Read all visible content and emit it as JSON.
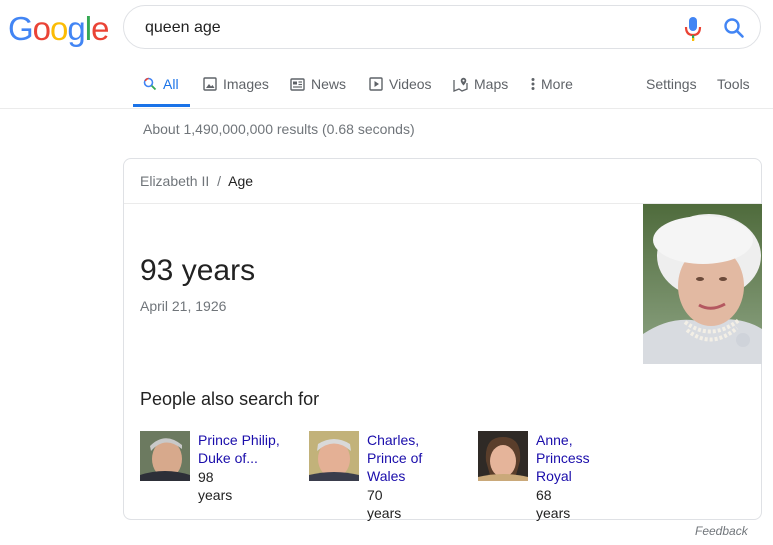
{
  "logo": {
    "letters": [
      "G",
      "o",
      "o",
      "g",
      "l",
      "e"
    ],
    "colors": [
      "#4285f4",
      "#ea4335",
      "#fbbc05",
      "#4285f4",
      "#34a853",
      "#ea4335"
    ]
  },
  "search": {
    "query": "queen age"
  },
  "tabs": [
    {
      "label": "All",
      "icon": "search-icon",
      "active": true
    },
    {
      "label": "Images",
      "icon": "image-icon"
    },
    {
      "label": "News",
      "icon": "news-icon"
    },
    {
      "label": "Videos",
      "icon": "video-icon"
    },
    {
      "label": "Maps",
      "icon": "map-pin-icon"
    },
    {
      "label": "More",
      "icon": "more-vert-icon"
    }
  ],
  "settings_label": "Settings",
  "tools_label": "Tools",
  "result_stats": "About 1,490,000,000 results (0.68 seconds)",
  "card": {
    "breadcrumb_parent": "Elizabeth II",
    "breadcrumb_sep": "/",
    "breadcrumb_current": "Age",
    "age": "93 years",
    "dob": "April 21, 1926",
    "people_heading": "People also search for",
    "people": [
      {
        "name_lines": [
          "Prince Philip,",
          "Duke of..."
        ],
        "years": "98 years"
      },
      {
        "name_lines": [
          "Charles,",
          "Prince of",
          "Wales"
        ],
        "years": "70 years"
      },
      {
        "name_lines": [
          "Anne,",
          "Princess",
          "Royal"
        ],
        "years": "68 years"
      }
    ]
  },
  "feedback": "Feedback",
  "colors": {
    "accent": "#1a73e8",
    "link": "#1a0dab",
    "muted": "#70757a"
  }
}
